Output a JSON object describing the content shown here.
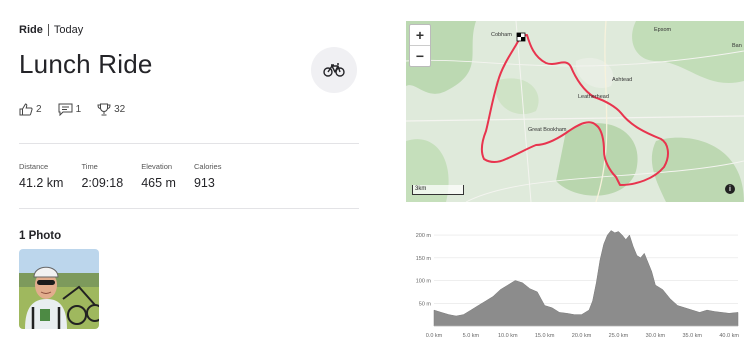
{
  "breadcrumb": {
    "sport": "Ride",
    "date": "Today"
  },
  "activity": {
    "title": "Lunch Ride",
    "sport_icon": "bike-icon"
  },
  "social": {
    "kudos": "2",
    "comments": "1",
    "achievements": "32"
  },
  "stats": [
    {
      "label": "Distance",
      "value": "41.2 km"
    },
    {
      "label": "Time",
      "value": "2:09:18"
    },
    {
      "label": "Elevation",
      "value": "465 m"
    },
    {
      "label": "Calories",
      "value": "913"
    }
  ],
  "photos": {
    "heading": "1 Photo"
  },
  "map": {
    "zoom_in": "+",
    "zoom_out": "−",
    "scale": "3km",
    "info": "i",
    "route_color": "#e8344e",
    "places": {
      "cobham": "Cobham",
      "epsom": "Epsom",
      "ashtead": "Ashtead",
      "leatherhead": "Leatherhead",
      "great_bookham": "Great Bookham",
      "ban": "Ban"
    }
  },
  "chart_data": {
    "type": "area",
    "x_unit": "km",
    "y_unit": "m",
    "xlim": [
      0,
      41.2
    ],
    "ylim": [
      0,
      220
    ],
    "x_ticks": [
      "0.0 km",
      "5.0 km",
      "10.0 km",
      "15.0 km",
      "20.0 km",
      "25.0 km",
      "30.0 km",
      "35.0 km",
      "40.0 km"
    ],
    "y_ticks": [
      "50 m",
      "100 m",
      "150 m",
      "200 m"
    ],
    "color": "#8c8c8c",
    "x": [
      0,
      1,
      2,
      3,
      4,
      5,
      6,
      7,
      8,
      9,
      10,
      11,
      12,
      13,
      14,
      14.5,
      15,
      16,
      17,
      18,
      19,
      20,
      21,
      21.5,
      22,
      22.5,
      23,
      23.5,
      24,
      24.5,
      25,
      25.5,
      26,
      26.5,
      27,
      27.5,
      28,
      28.5,
      29,
      29.5,
      30,
      31,
      32,
      33,
      34,
      35,
      36,
      37,
      38,
      39,
      40,
      41.2
    ],
    "y": [
      35,
      30,
      25,
      22,
      25,
      35,
      45,
      55,
      65,
      80,
      90,
      100,
      95,
      82,
      75,
      60,
      45,
      40,
      30,
      28,
      25,
      25,
      35,
      55,
      95,
      145,
      180,
      200,
      210,
      205,
      208,
      200,
      190,
      200,
      175,
      155,
      150,
      160,
      140,
      120,
      90,
      80,
      60,
      45,
      40,
      35,
      30,
      35,
      32,
      30,
      28,
      30
    ]
  }
}
